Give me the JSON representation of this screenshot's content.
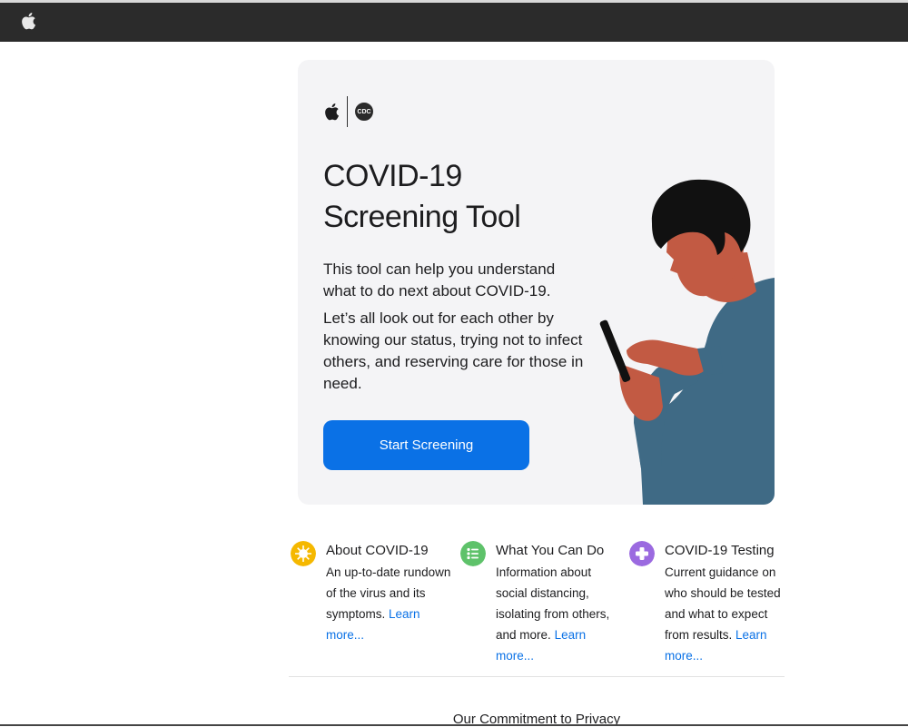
{
  "topbar": {
    "logo_icon": "apple-logo-icon"
  },
  "hero": {
    "logos": {
      "apple_icon": "apple-logo-icon",
      "cdc_label": "CDC"
    },
    "title_line1": "COVID-19",
    "title_line2": "Screening Tool",
    "paragraph1": "This tool can help you understand what to do next about COVID-19.",
    "paragraph2": "Let’s all look out for each other by knowing our status, trying not to infect others, and reserving care for those in need.",
    "start_button_label": "Start Screening",
    "illustration": "person-using-phone-illustration"
  },
  "cards": [
    {
      "icon": "virus-icon",
      "icon_color": "#f5b800",
      "title": "About COVID-19",
      "description": "An up-to-date rundown of the virus and its symptoms.",
      "link": "Learn more..."
    },
    {
      "icon": "checklist-icon",
      "icon_color": "#5ec26a",
      "title": "What You Can Do",
      "description": "Information about social distancing, isolating from others, and more.",
      "link": "Learn more..."
    },
    {
      "icon": "medical-cross-icon",
      "icon_color": "#9b6ae0",
      "title": "COVID-19 Testing",
      "description": "Current guidance on who should be tested and what to expect from results.",
      "link": "Learn more..."
    }
  ],
  "footer": {
    "privacy_heading": "Our Commitment to Privacy"
  },
  "colors": {
    "accent": "#0a71e6",
    "topbar": "#2b2b2b",
    "hero_bg": "#f4f4f6"
  }
}
